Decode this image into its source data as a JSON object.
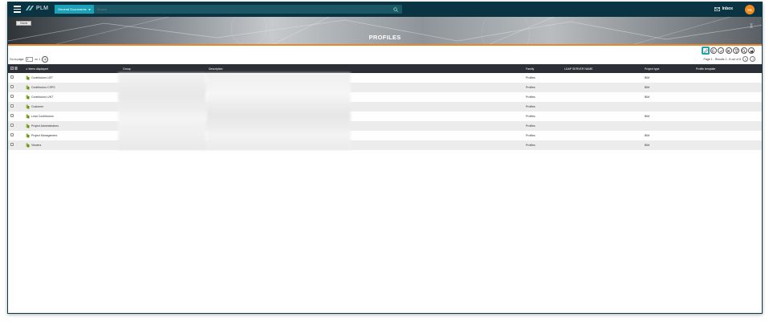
{
  "app": {
    "logo_text": "PLM"
  },
  "search": {
    "scope_label": "General Documents",
    "placeholder": "Search"
  },
  "header": {
    "inbox_label": "Inbox",
    "avatar_initials": "PS"
  },
  "banner": {
    "back_label": "Home",
    "title": "PROFILES"
  },
  "paging": {
    "goto_label": "Go to page:",
    "goto_value": "1",
    "of_label": "on 1",
    "summary": "Page 1 - Results 1 - 8 out of 8"
  },
  "table": {
    "columns": {
      "name": "∧ Items displayed",
      "group": "Group",
      "description": "Description",
      "family": "Family",
      "ldap": "LDAP SERVER NAME",
      "project_type": "Project type",
      "profile_template": "Profile template"
    },
    "rows": [
      {
        "name": "Contributors UET",
        "family": "Profiles",
        "project_type": "BIM"
      },
      {
        "name": "Contributors CSPS",
        "family": "Profiles",
        "project_type": "BIM"
      },
      {
        "name": "Contributors UNT",
        "family": "Profiles",
        "project_type": "BIM"
      },
      {
        "name": "Customer",
        "family": "Profiles",
        "project_type": ""
      },
      {
        "name": "Lead Contributors",
        "family": "Profiles",
        "project_type": "BIM"
      },
      {
        "name": "Project Administrators",
        "family": "Profiles",
        "project_type": ""
      },
      {
        "name": "Project Management",
        "family": "Profiles",
        "project_type": "BIM"
      },
      {
        "name": "Viewers",
        "family": "Profiles",
        "project_type": "BIM"
      }
    ]
  },
  "colors": {
    "nav": "#0b3443",
    "accent": "#1aa3b8",
    "stripe": "#e9882a",
    "table_header": "#2c3036",
    "avatar": "#f28a1c"
  },
  "icons": [
    "menu-icon",
    "plm-logo-icon",
    "search-icon",
    "mail-icon",
    "collapse-icon",
    "edit-icon",
    "refresh-icon",
    "check-icon",
    "close-icon",
    "filter-icon",
    "search-icon",
    "export-icon",
    "arrow-right-icon",
    "profile-icon"
  ]
}
